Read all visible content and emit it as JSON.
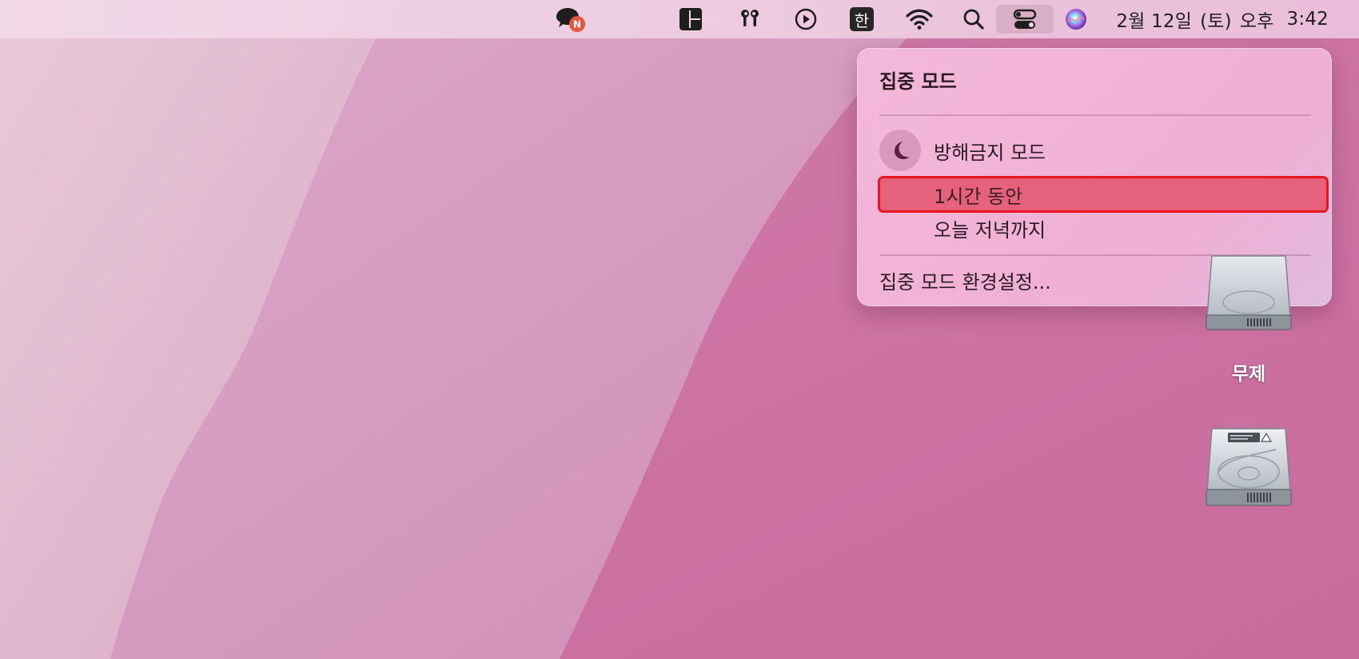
{
  "menubar": {
    "items": [
      {
        "name": "messenger-badge",
        "icon": "chat-bubble-icon",
        "badge": "N"
      },
      {
        "name": "layout",
        "icon": "window-layout-icon"
      },
      {
        "name": "airpods",
        "icon": "airpods-icon"
      },
      {
        "name": "media",
        "icon": "play-circle-icon"
      },
      {
        "name": "input-source",
        "icon": "hangul-input-icon",
        "label": "한"
      },
      {
        "name": "wifi",
        "icon": "wifi-icon"
      },
      {
        "name": "spotlight",
        "icon": "search-icon"
      },
      {
        "name": "control-center",
        "icon": "control-center-icon",
        "active": true
      },
      {
        "name": "siri",
        "icon": "siri-icon"
      }
    ],
    "clock": {
      "date": "2월 12일",
      "weekday": "(토)",
      "ampm": "오후",
      "time": "3:42"
    }
  },
  "focus_menu": {
    "title": "집중 모드",
    "mode": {
      "label": "방해금지 모드",
      "icon": "moon-icon"
    },
    "options": [
      {
        "label": "1시간 동안",
        "highlighted": true
      },
      {
        "label": "오늘 저녁까지",
        "highlighted": false
      }
    ],
    "settings_label": "집중 모드 환경설정..."
  },
  "desktop": {
    "icons": [
      {
        "label": "무제",
        "icon": "hard-disk-icon"
      },
      {
        "label": "",
        "icon": "hard-disk-icon"
      }
    ]
  },
  "colors": {
    "highlight_border": "#e8141e",
    "highlight_fill": "#e6627c",
    "wallpaper_pink": "#c96ea0"
  }
}
